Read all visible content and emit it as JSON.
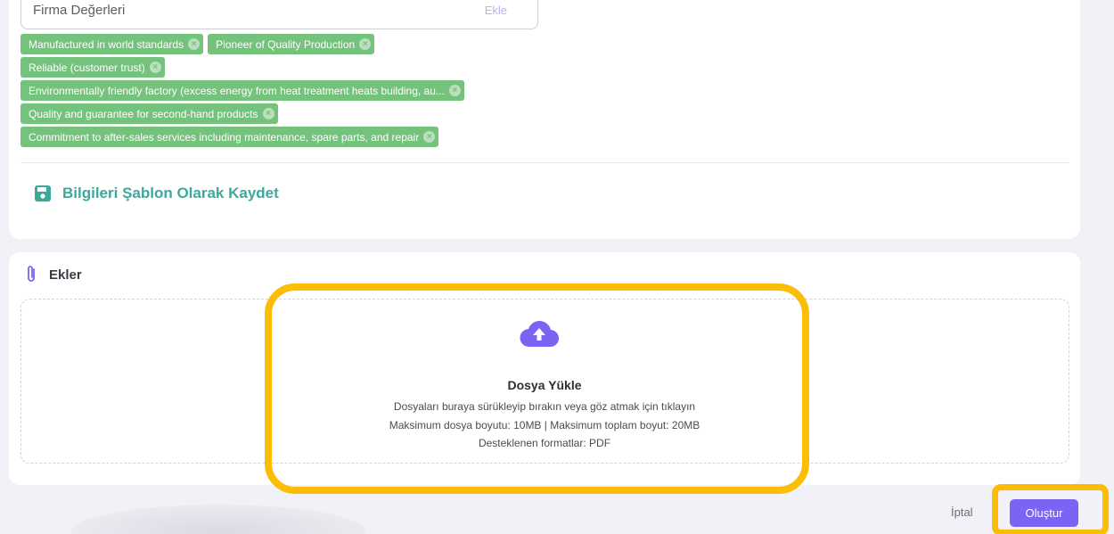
{
  "values_field": {
    "placeholder": "Firma Değerleri",
    "add_label": "Ekle"
  },
  "tags": [
    [
      "Manufactured in world standards",
      "Pioneer of Quality Production"
    ],
    [
      "Reliable (customer trust)"
    ],
    [
      "Environmentally friendly factory (excess energy from heat treatment heats building, au..."
    ],
    [
      "Quality and guarantee for second-hand products"
    ],
    [
      "Commitment to after-sales services including maintenance, spare parts, and repair"
    ]
  ],
  "tag_remove_symbol": "×",
  "save_template_label": "Bilgileri Şablon Olarak Kaydet",
  "attachments": {
    "title": "Ekler",
    "upload_title": "Dosya Yükle",
    "upload_hint": "Dosyaları buraya sürükleyip bırakın veya göz atmak için tıklayın",
    "upload_limits": "Maksimum dosya boyutu: 10MB | Maksimum toplam boyut: 20MB",
    "upload_formats": "Desteklenen formatlar: PDF"
  },
  "footer": {
    "cancel_label": "İptal",
    "create_label": "Oluştur"
  },
  "colors": {
    "accent": "#7c63f3",
    "tag": "#74c27c",
    "save": "#3ba99b",
    "highlight": "#fbbd05"
  }
}
